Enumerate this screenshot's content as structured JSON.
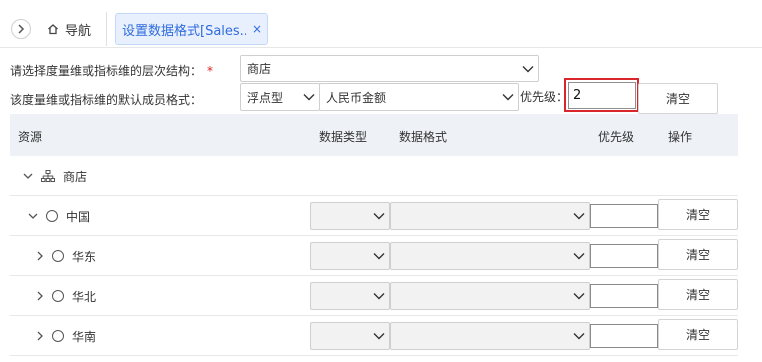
{
  "topbar": {
    "nav_label": "导航",
    "active_tab_label": "设置数据格式[Sales...",
    "close_glyph": "×"
  },
  "form": {
    "hierarchy_label": "请选择度量维或指标维的层次结构：",
    "required_mark": "*",
    "hierarchy_value": "商店",
    "default_format_label": "该度量维或指标维的默认成员格式：",
    "data_type_value": "浮点型",
    "data_format_value": "人民币金额",
    "priority_label": "优先级：",
    "priority_value": "2",
    "clear_button": "清空"
  },
  "table": {
    "headers": {
      "resource": "资源",
      "data_type": "数据类型",
      "data_format": "数据格式",
      "priority": "优先级",
      "action": "操作"
    },
    "root": {
      "label": "商店",
      "icon": "hierarchy-icon"
    },
    "rows": [
      {
        "label": "中国",
        "clear": "清空",
        "expanded": true
      },
      {
        "label": "华东",
        "clear": "清空",
        "expanded": false
      },
      {
        "label": "华北",
        "clear": "清空",
        "expanded": false
      },
      {
        "label": "华南",
        "clear": "清空",
        "expanded": false
      }
    ]
  },
  "colors": {
    "accent": "#2f6bdc",
    "highlight_frame": "#d9262a",
    "header_bg": "#eef1f6"
  }
}
